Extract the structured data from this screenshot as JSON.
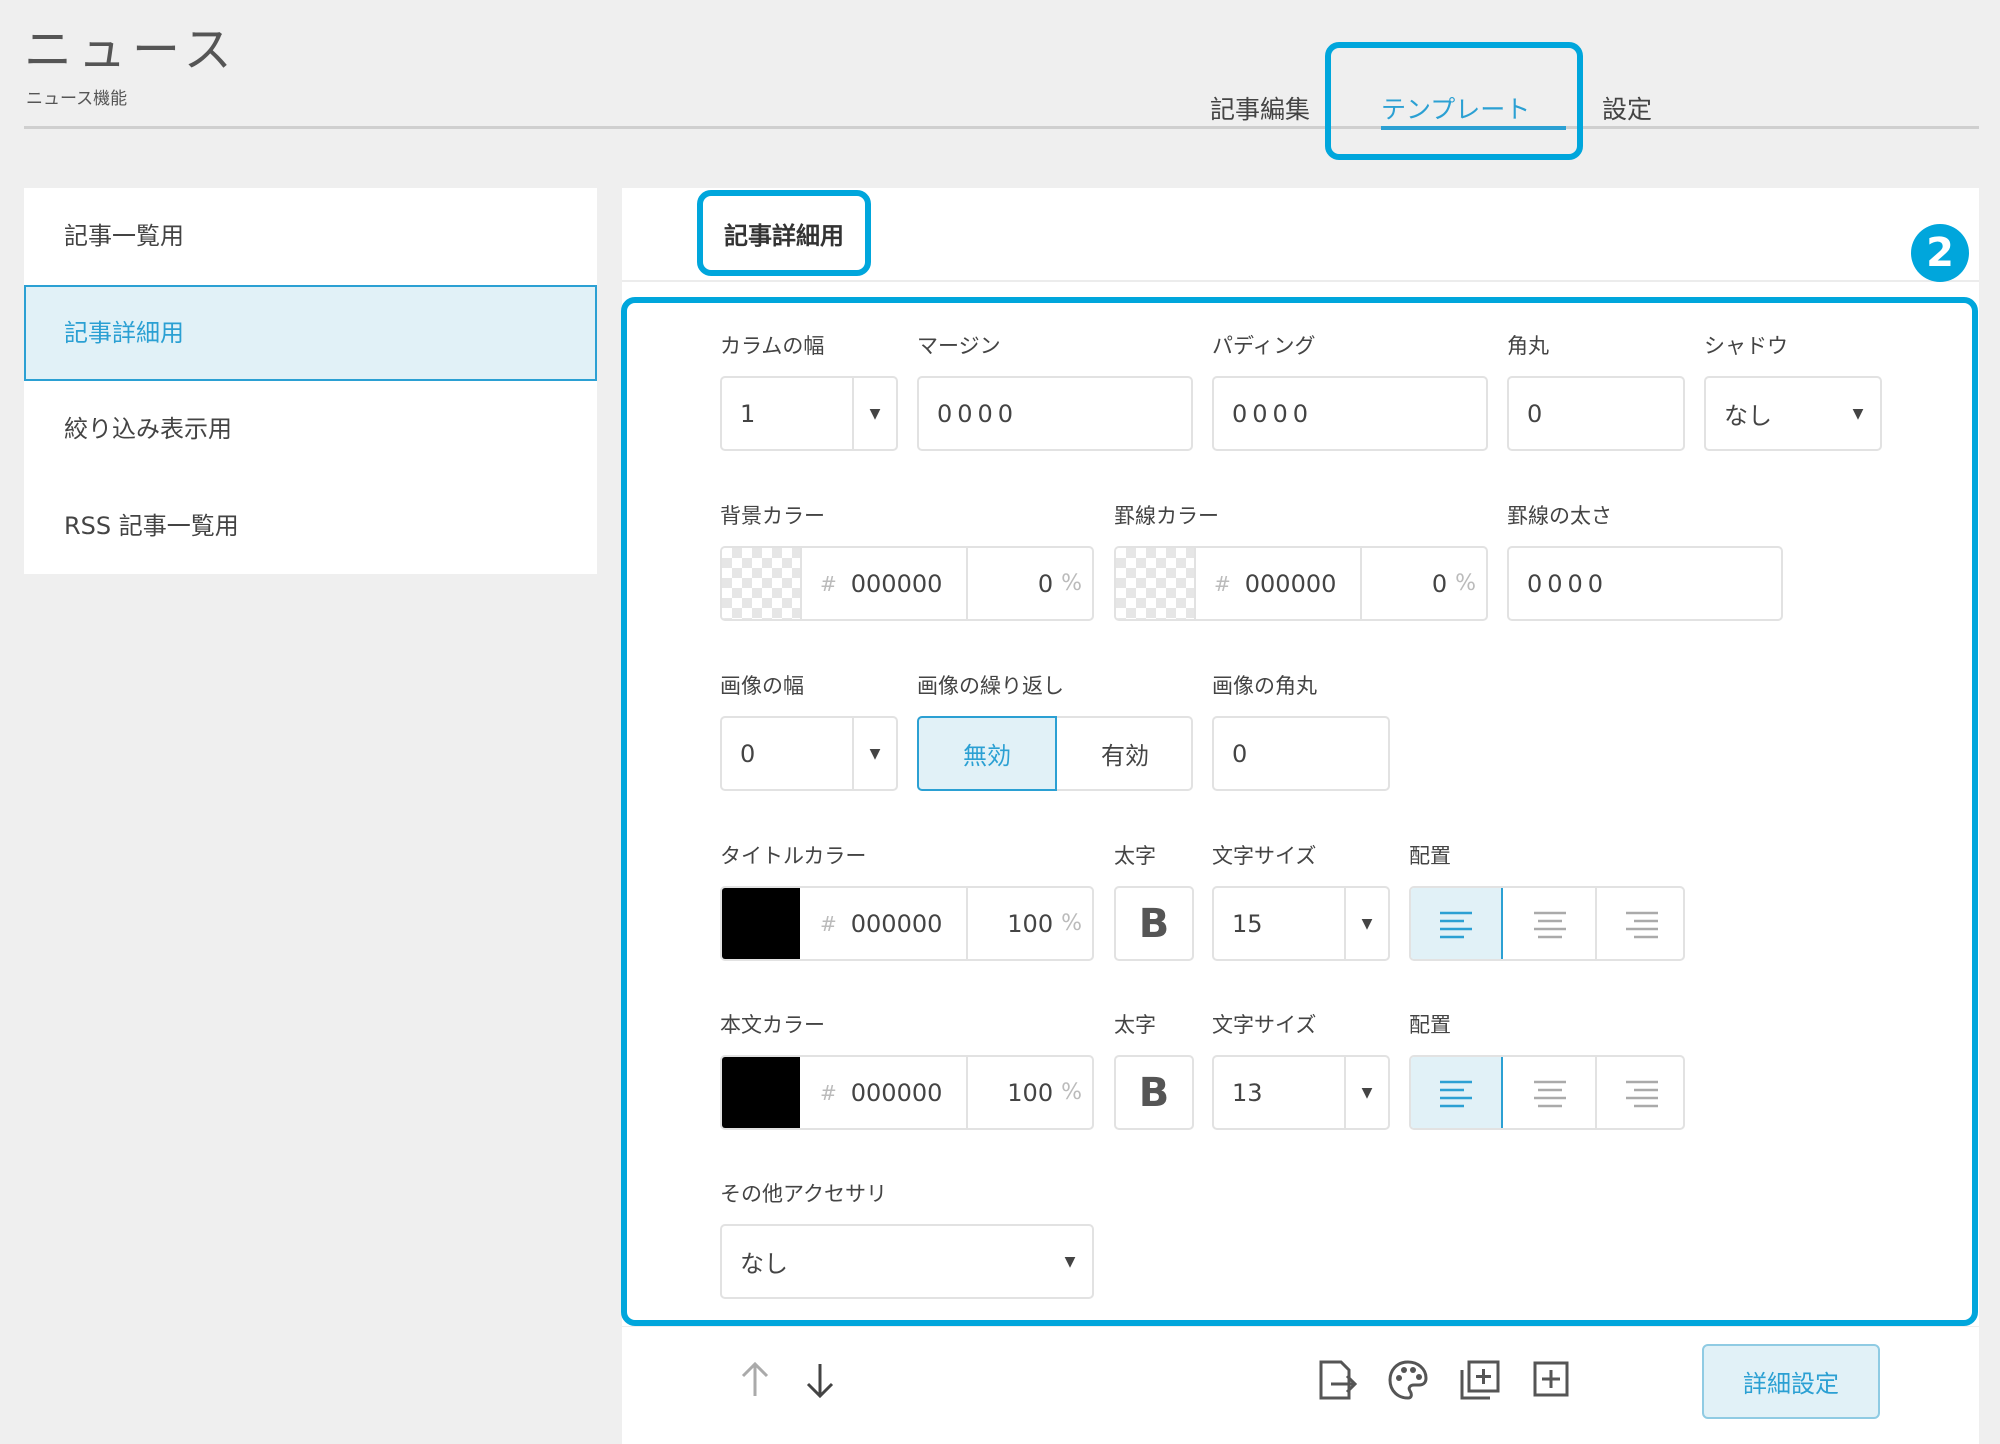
{
  "header": {
    "title": "ニュース",
    "subtitle": "ニュース機能",
    "tabs": [
      {
        "label": "記事編集"
      },
      {
        "label": "テンプレート"
      },
      {
        "label": "設定"
      }
    ]
  },
  "sidebar": {
    "items": [
      {
        "label": "記事一覧用"
      },
      {
        "label": "記事詳細用"
      },
      {
        "label": "絞り込み表示用"
      },
      {
        "label": "RSS 記事一覧用"
      }
    ]
  },
  "panel": {
    "title": "記事詳細用",
    "badge": "2"
  },
  "form": {
    "column_width": {
      "label": "カラムの幅",
      "value": "1"
    },
    "margin": {
      "label": "マージン",
      "value": "0000"
    },
    "padding": {
      "label": "パディング",
      "value": "0000"
    },
    "radius": {
      "label": "角丸",
      "value": "0"
    },
    "shadow": {
      "label": "シャドウ",
      "value": "なし"
    },
    "bg_color": {
      "label": "背景カラー",
      "hash": "#",
      "hex": "000000",
      "opacity": "0",
      "pct": "%"
    },
    "border_color": {
      "label": "罫線カラー",
      "hash": "#",
      "hex": "000000",
      "opacity": "0",
      "pct": "%"
    },
    "border_width": {
      "label": "罫線の太さ",
      "value": "0000"
    },
    "image_width": {
      "label": "画像の幅",
      "value": "0"
    },
    "image_repeat": {
      "label": "画像の繰り返し",
      "options": [
        "無効",
        "有効"
      ],
      "selected": "無効"
    },
    "image_radius": {
      "label": "画像の角丸",
      "value": "0"
    },
    "title_color": {
      "label": "タイトルカラー",
      "hash": "#",
      "hex": "000000",
      "opacity": "100",
      "pct": "%",
      "swatch": "#000000"
    },
    "title_bold": {
      "label": "太字",
      "glyph": "B"
    },
    "title_size": {
      "label": "文字サイズ",
      "value": "15"
    },
    "title_align": {
      "label": "配置",
      "selected": "left"
    },
    "body_color": {
      "label": "本文カラー",
      "hash": "#",
      "hex": "000000",
      "opacity": "100",
      "pct": "%",
      "swatch": "#000000"
    },
    "body_bold": {
      "label": "太字",
      "glyph": "B"
    },
    "body_size": {
      "label": "文字サイズ",
      "value": "13"
    },
    "body_align": {
      "label": "配置",
      "selected": "left"
    },
    "accessory": {
      "label": "その他アクセサリ",
      "value": "なし"
    }
  },
  "footer": {
    "detail_button": "詳細設定"
  },
  "colors": {
    "accent": "#2ba0d3",
    "highlight": "#00a6dc",
    "selected_bg": "#e1f1f7"
  },
  "icons": [
    "arrow-up-icon",
    "arrow-down-icon",
    "export-icon",
    "palette-icon",
    "duplicate-icon",
    "add-icon",
    "caret-down-icon",
    "align-left-icon",
    "align-center-icon",
    "align-right-icon"
  ]
}
